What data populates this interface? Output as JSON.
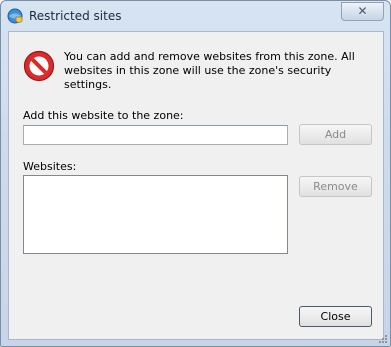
{
  "window": {
    "title": "Restricted sites",
    "close_glyph": "✕",
    "app_icon": "ie-globe-shield-icon"
  },
  "info": {
    "icon": "restricted-stop-icon",
    "text": "You can add and remove websites from this zone. All websites in this zone will use the zone's security settings.",
    "icon_color": "#d92b2b"
  },
  "add_section": {
    "label": "Add this website to the zone:",
    "input_value": "",
    "add_button": "Add",
    "add_enabled": false
  },
  "websites_section": {
    "label": "Websites:",
    "items": [],
    "remove_button": "Remove",
    "remove_enabled": false
  },
  "footer": {
    "close_button": "Close"
  }
}
